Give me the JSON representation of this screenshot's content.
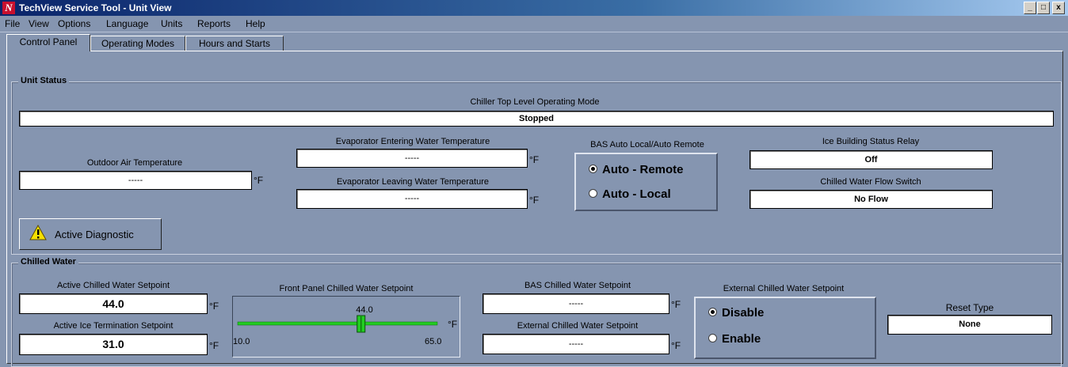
{
  "window": {
    "title": "TechView Service Tool - Unit View",
    "app_icon": "N"
  },
  "window_controls": {
    "minimize": "_",
    "maximize": "□",
    "close": "x"
  },
  "menu": [
    "File",
    "View",
    "Options",
    "Language",
    "Units",
    "Reports",
    "Help"
  ],
  "tabs": [
    "Control Panel",
    "Operating Modes",
    "Hours and Starts"
  ],
  "active_tab": "Control Panel",
  "unit_status": {
    "title": "Unit Status",
    "top_mode_label": "Chiller Top Level Operating Mode",
    "top_mode_value": "Stopped",
    "outdoor_air": {
      "label": "Outdoor Air Temperature",
      "value": "-----",
      "unit": "°F"
    },
    "evap_entering": {
      "label": "Evaporator Entering Water Temperature",
      "value": "-----",
      "unit": "°F"
    },
    "evap_leaving": {
      "label": "Evaporator Leaving Water Temperature",
      "value": "-----",
      "unit": "°F"
    },
    "bas": {
      "label": "BAS Auto Local/Auto Remote",
      "option_remote": "Auto - Remote",
      "option_local": "Auto - Local",
      "selected": "Auto - Remote"
    },
    "ice_relay": {
      "label": "Ice Building Status Relay",
      "value": "Off"
    },
    "flow_switch": {
      "label": "Chilled Water Flow Switch",
      "value": "No Flow"
    },
    "diagnostic_button": "Active Diagnostic"
  },
  "chilled_water": {
    "title": "Chilled Water",
    "active_setpoint": {
      "label": "Active Chilled Water Setpoint",
      "value": "44.0",
      "unit": "°F"
    },
    "ice_termination": {
      "label": "Active Ice Termination Setpoint",
      "value": "31.0",
      "unit": "°F"
    },
    "front_panel": {
      "label": "Front Panel Chilled Water Setpoint",
      "value": "44.0",
      "min": "10.0",
      "max": "65.0",
      "unit": "°F",
      "level": 0.618
    },
    "bas_setpoint": {
      "label": "BAS Chilled Water Setpoint",
      "value": "-----",
      "unit": "°F"
    },
    "external_setpoint_value": {
      "label": "External Chilled Water Setpoint",
      "value": "-----",
      "unit": "°F"
    },
    "external_setpoint_mode": {
      "label": "External Chilled Water Setpoint",
      "option_disable": "Disable",
      "option_enable": "Enable",
      "selected": "Disable"
    },
    "reset_type": {
      "label": "Reset Type",
      "value": "None"
    }
  },
  "colors": {
    "background": "#8595b0",
    "slider_track": "#22cc22",
    "title_bar": "#0a246a",
    "warning": "#f5e000"
  }
}
